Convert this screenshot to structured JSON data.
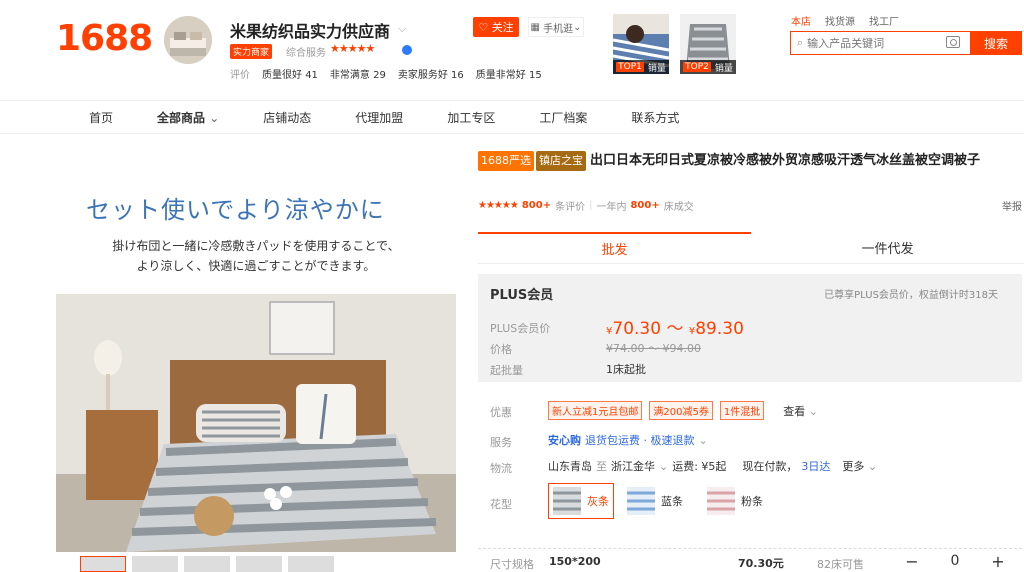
{
  "header": {
    "logo": "1688",
    "shop_name": "米果纺织品实力供应商",
    "badge_strong": "实力商家",
    "service_label": "综合服务",
    "stars": "★★★★★",
    "ratings_label": "评价",
    "ratings": [
      {
        "label": "质量很好",
        "count": "41"
      },
      {
        "label": "非常满意",
        "count": "29"
      },
      {
        "label": "卖家服务好",
        "count": "16"
      },
      {
        "label": "质量非常好",
        "count": "15"
      }
    ],
    "follow_label": "关注",
    "mobile_label": "手机逛",
    "top_items": [
      {
        "rank": "TOP1",
        "label": "销量"
      },
      {
        "rank": "TOP2",
        "label": "销量"
      }
    ],
    "search_tabs": [
      "本店",
      "找货源",
      "找工厂"
    ],
    "search_placeholder": "输入产品关键词",
    "search_button": "搜索"
  },
  "nav": {
    "items": [
      "首页",
      "全部商品",
      "店铺动态",
      "代理加盟",
      "加工专区",
      "工厂档案",
      "联系方式"
    ],
    "active": "全部商品"
  },
  "gallery": {
    "headline": "セット使いでより涼やかに",
    "caption_line1": "掛け布団と一緒に冷感敷きパッドを使用することで、",
    "caption_line2": "より涼しく、快適に過ごすことができます。"
  },
  "product": {
    "tag_yanxuan": "1688严选",
    "tag_zhenbao": "镇店之宝",
    "title": "出口日本无印日式夏凉被冷感被外贸凉感吸汗透气冰丝盖被空调被子",
    "stars": "★★★★★",
    "review_count": "800+",
    "review_label": "条评价",
    "year_label": "一年内",
    "sold_count": "800+",
    "sold_label": "床成交",
    "report": "举报"
  },
  "tabs": [
    "批发",
    "一件代发"
  ],
  "plus": {
    "title": "PLUS会员",
    "note": "已尊享PLUS会员价，权益倒计时318天",
    "price_label": "PLUS会员价",
    "price_low": "70.30",
    "price_high": "89.30",
    "currency": "¥",
    "old_label": "价格",
    "old_price": "¥74.00 ～ ¥94.00",
    "moq_label": "起批量",
    "moq": "1床起批"
  },
  "offers": {
    "label": "优惠",
    "coupons": [
      "新人立减1元且包邮",
      "满200减5券",
      "1件混批"
    ],
    "more": "查看"
  },
  "service": {
    "label": "服务",
    "safe": "安心购",
    "items": "退货包运费 · 极速退款"
  },
  "logistics": {
    "label": "物流",
    "from": "山东青岛",
    "to_label": "至",
    "to": "浙江金华",
    "freight": "运费: ¥5起",
    "pay": "现在付款，",
    "arrive": "3日达",
    "more": "更多"
  },
  "pattern": {
    "label": "花型",
    "options": [
      "灰条",
      "蓝条",
      "粉条"
    ],
    "selected": "灰条"
  },
  "size_row": {
    "label": "尺寸规格",
    "size": "150*200",
    "price": "70.30元",
    "stock": "82床可售",
    "qty": "0"
  }
}
